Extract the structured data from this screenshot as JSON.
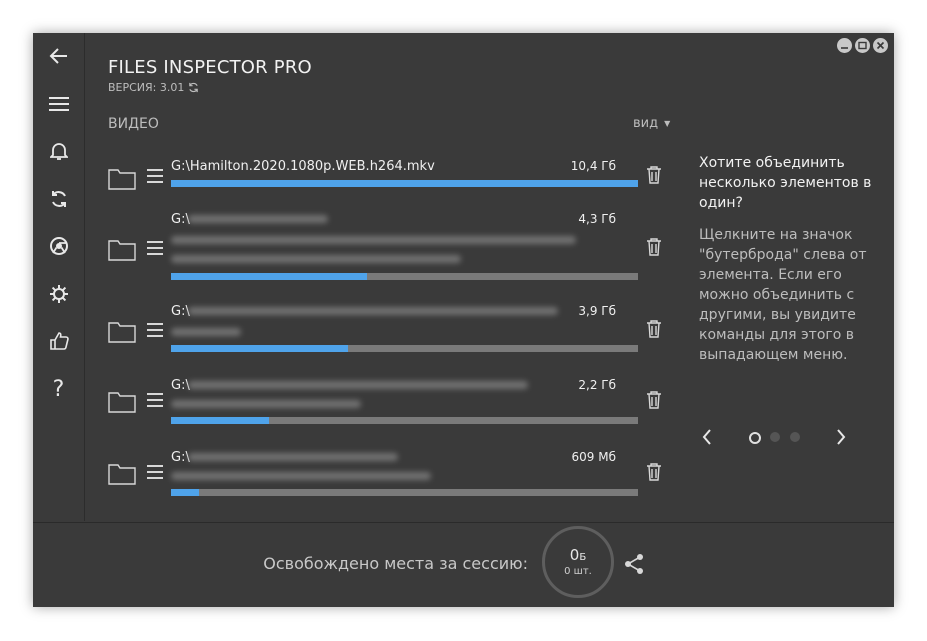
{
  "app": {
    "title": "FILES INSPECTOR PRO",
    "version": "ВЕРСИЯ: 3.01"
  },
  "window_controls": [
    "minimize-icon",
    "maximize-icon",
    "close-icon"
  ],
  "sidebar": {
    "items": [
      {
        "icon": "back-arrow-icon"
      },
      {
        "icon": "menu-icon"
      },
      {
        "icon": "bell-icon"
      },
      {
        "icon": "refresh-icon"
      },
      {
        "icon": "chrome-icon"
      },
      {
        "icon": "gear-icon"
      },
      {
        "icon": "thumbs-up-icon"
      },
      {
        "icon": "help-icon"
      }
    ]
  },
  "list": {
    "section_title": "ВИДЕО",
    "view_label": "вид",
    "items": [
      {
        "path": "G:\\Hamilton.2020.1080p.WEB.h264.mkv",
        "size": "10,4 Гб",
        "progress": 1.0
      },
      {
        "path": "G:\\",
        "size": "4,3 Гб",
        "progress": 0.42
      },
      {
        "path": "G:\\",
        "size": "3,9 Гб",
        "progress": 0.38
      },
      {
        "path": "G:\\",
        "size": "2,2 Гб",
        "progress": 0.21
      },
      {
        "path": "G:\\",
        "size": "609 Мб",
        "progress": 0.06
      }
    ]
  },
  "tip": {
    "title": "Хотите объединить несколько элементов в один?",
    "body": "Щелкните на значок \"бутерброда\" слева от элемента. Если его можно объединить с другими, вы увидите команды для этого в выпадающем меню.",
    "page_count": 3,
    "active_page": 1
  },
  "footer": {
    "label": "Освобождено места за сессию:",
    "freed_value": "0",
    "freed_unit": "Б",
    "count": "0 шт."
  },
  "colors": {
    "background": "#3a3a3a",
    "accent": "#4fa3ea",
    "track": "#7a7a7a"
  }
}
